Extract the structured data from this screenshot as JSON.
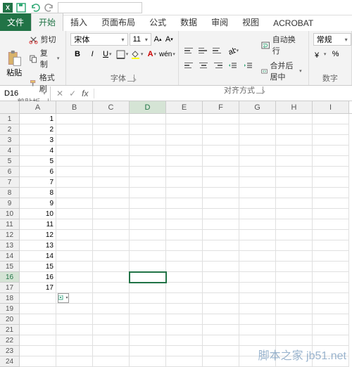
{
  "qat": {
    "input_placeholder": ""
  },
  "tabs": {
    "file": "文件",
    "home": "开始",
    "insert": "插入",
    "layout": "页面布局",
    "formulas": "公式",
    "data": "数据",
    "review": "审阅",
    "view": "视图",
    "acrobat": "ACROBAT"
  },
  "ribbon": {
    "clipboard": {
      "paste": "粘贴",
      "cut": "剪切",
      "copy": "复制",
      "format_painter": "格式刷",
      "label": "剪贴板"
    },
    "font": {
      "name": "宋体",
      "size": "11",
      "label": "字体"
    },
    "align": {
      "wrap": "自动换行",
      "merge": "合并后居中",
      "label": "对齐方式"
    },
    "number": {
      "format": "常规",
      "label": "数字"
    }
  },
  "namebox": {
    "ref": "D16"
  },
  "columns": [
    "A",
    "B",
    "C",
    "D",
    "E",
    "F",
    "G",
    "H",
    "I"
  ],
  "rows": [
    1,
    2,
    3,
    4,
    5,
    6,
    7,
    8,
    9,
    10,
    11,
    12,
    13,
    14,
    15,
    16,
    17,
    18,
    19,
    20,
    21,
    22,
    23,
    24
  ],
  "cells": {
    "A1": "1",
    "A2": "2",
    "A3": "3",
    "A4": "4",
    "A5": "5",
    "A6": "6",
    "A7": "7",
    "A8": "8",
    "A9": "9",
    "A10": "10",
    "A11": "11",
    "A12": "12",
    "A13": "13",
    "A14": "14",
    "A15": "15",
    "A16": "16",
    "A17": "17"
  },
  "active_cell": "D16",
  "autofill_at": {
    "col": "B",
    "row": 18
  },
  "watermark": "脚本之家 jb51.net"
}
